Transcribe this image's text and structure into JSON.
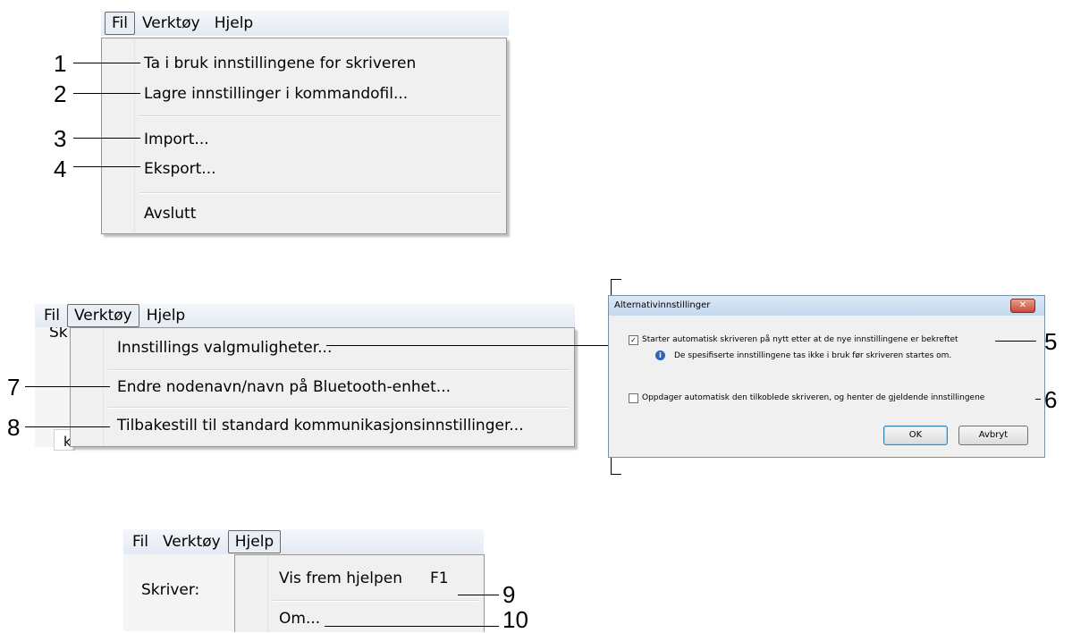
{
  "menus": {
    "fil_label": "Fil",
    "verktoy_label": "Verktøy",
    "hjelp_label": "Hjelp"
  },
  "fil_menu": {
    "items": [
      {
        "label": "Ta i bruk innstillingene for skriveren",
        "callout": "1"
      },
      {
        "label": "Lagre innstillinger i kommandofil...",
        "callout": "2"
      },
      {
        "label": "Import...",
        "callout": "3"
      },
      {
        "label": "Eksport...",
        "callout": "4"
      },
      {
        "label": "Avslutt",
        "callout": ""
      }
    ]
  },
  "verktoy_menu": {
    "background_label": "Sk",
    "background_char": "k",
    "items": [
      {
        "label": "Innstillings valgmuligheter...",
        "callout": ""
      },
      {
        "label": "Endre nodenavn/navn på Bluetooth-enhet...",
        "callout": "7"
      },
      {
        "label": "Tilbakestill til standard kommunikasjonsinnstillinger...",
        "callout": "8"
      }
    ]
  },
  "dialog": {
    "title": "Alternativinnstillinger",
    "close_glyph": "✕",
    "option1_label": "Starter automatisk skriveren på nytt etter at de nye innstillingene er bekreftet",
    "option1_checked": true,
    "option1_callout": "5",
    "info_text": "De spesifiserte innstillingene tas ikke i bruk før skriveren startes om.",
    "option2_label": "Oppdager automatisk den tilkoblede skriveren, og henter de gjeldende innstillingene",
    "option2_checked": false,
    "option2_callout": "6",
    "ok_label": "OK",
    "cancel_label": "Avbryt"
  },
  "hjelp_menu": {
    "background_label": "Skriver:",
    "items": [
      {
        "label": "Vis frem hjelpen",
        "shortcut": "F1",
        "callout": "9"
      },
      {
        "label": "Om...",
        "shortcut": "",
        "callout": "10"
      }
    ]
  }
}
